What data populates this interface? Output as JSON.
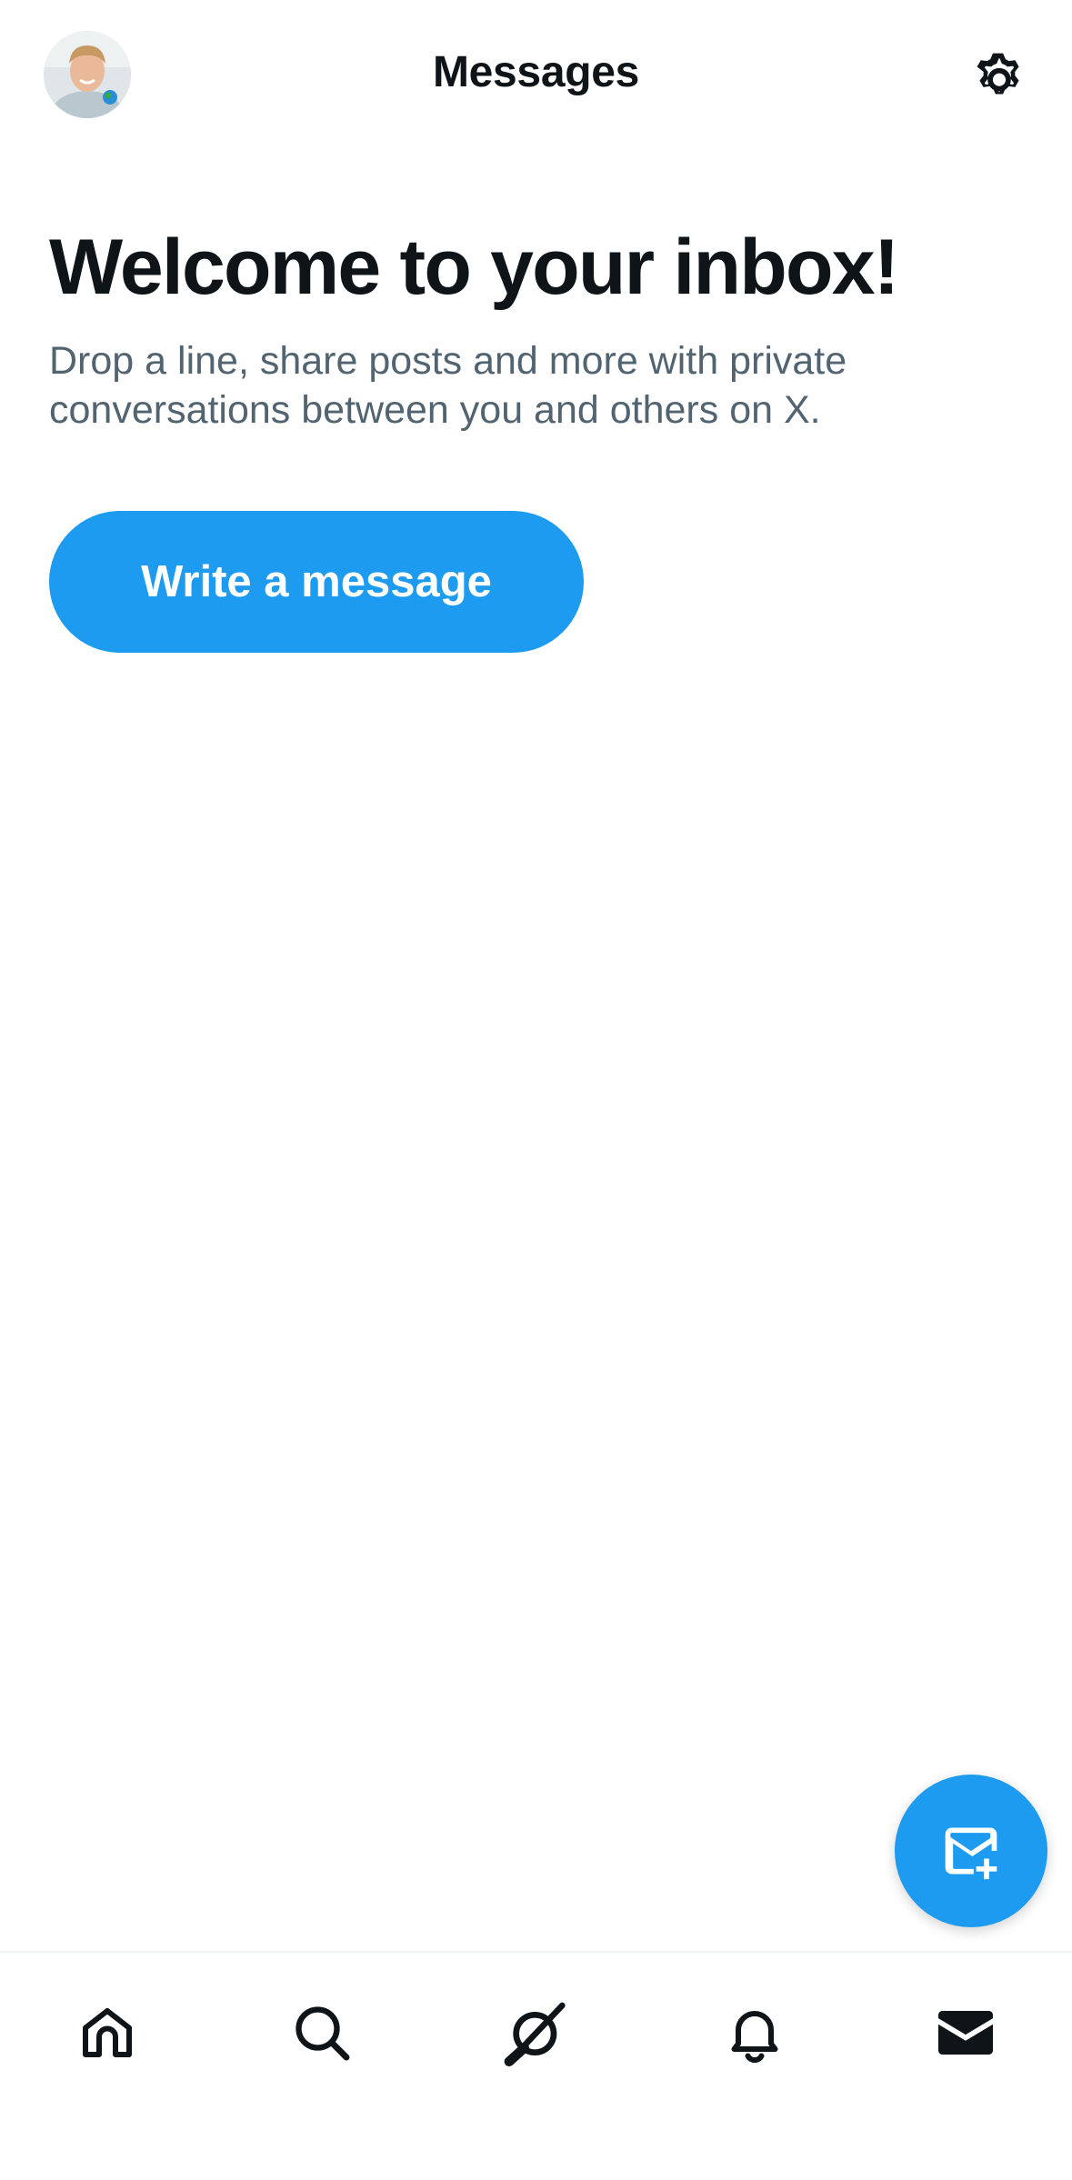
{
  "header": {
    "title": "Messages",
    "avatar_icon": "profile-avatar",
    "settings_icon": "gear-icon"
  },
  "welcome": {
    "title": "Welcome to your inbox!",
    "subtitle": "Drop a line, share posts and more with private conversations between you and others on X.",
    "button_label": "Write a message"
  },
  "fab": {
    "icon": "new-message-icon"
  },
  "bottom_nav": {
    "items": [
      {
        "id": "home",
        "icon": "home-icon"
      },
      {
        "id": "search",
        "icon": "search-icon"
      },
      {
        "id": "grok",
        "icon": "grok-icon"
      },
      {
        "id": "notifications",
        "icon": "bell-icon"
      },
      {
        "id": "messages",
        "icon": "envelope-icon",
        "active": true
      }
    ]
  },
  "colors": {
    "accent": "#1d9bf0",
    "text_primary": "#0f1419",
    "text_secondary": "#536471",
    "divider": "#eff3f4"
  }
}
